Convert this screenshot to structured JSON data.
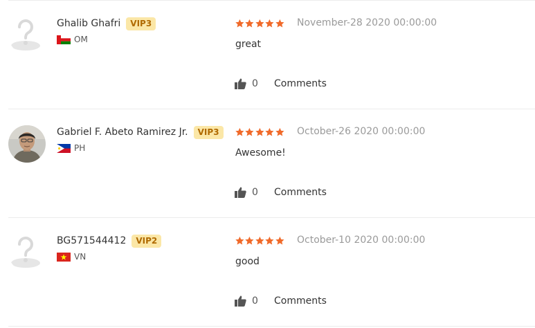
{
  "reviews": [
    {
      "avatar": "placeholder-avatar-icon",
      "username": "Ghalib Ghafri",
      "vip": "VIP3",
      "country_code": "OM",
      "flag": "oman-flag-icon",
      "rating": 5,
      "date": "November-28 2020 00:00:00",
      "text": "great",
      "likes": "0",
      "comments_label": "Comments"
    },
    {
      "avatar": "user-photo",
      "username": "Gabriel F. Abeto Ramirez Jr.",
      "vip": "VIP3",
      "country_code": "PH",
      "flag": "philippines-flag-icon",
      "rating": 5,
      "date": "October-26 2020 00:00:00",
      "text": "Awesome!",
      "likes": "0",
      "comments_label": "Comments"
    },
    {
      "avatar": "placeholder-avatar-icon",
      "username": "BG571544412",
      "vip": "VIP2",
      "country_code": "VN",
      "flag": "vietnam-flag-icon",
      "rating": 5,
      "date": "October-10 2020 00:00:00",
      "text": "good",
      "likes": "0",
      "comments_label": "Comments"
    }
  ],
  "colors": {
    "star": "#f06a2a",
    "vip_bg": "#fbe7a7",
    "vip_text": "#b06a00",
    "date": "#9a9a9a"
  }
}
